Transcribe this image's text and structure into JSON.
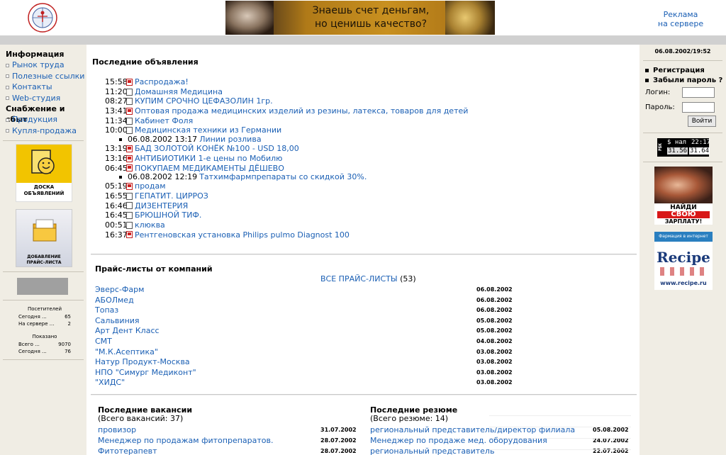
{
  "header": {
    "logo_text": "МЕДИЦИНСКАЯ БИРЖА РОССИИ",
    "banner_line1": "Знаешь счет деньгам,",
    "banner_line2": "но ценишь качество?",
    "ad_link_line1": "Реклама",
    "ad_link_line2": "на сервере"
  },
  "sidebar": {
    "group1": "Информация",
    "items1": [
      "Рынок труда",
      "Полезные ссылки",
      "Контакты",
      "Web-студия"
    ],
    "group2": "Снабжение и сбыт",
    "items2": [
      "Продукция",
      "Купля-продажа"
    ],
    "board_label_1": "ДОСКА",
    "board_label_2": "ОБЪЯВЛЕНИЙ",
    "price_label_1": "ДОБАВЛЕНИЕ",
    "price_label_2": "ПРАЙС-ЛИСТА",
    "visitors_title": "Посетителей",
    "visitors": [
      {
        "label": "Сегодня ...",
        "value": "65"
      },
      {
        "label": "На сервере ...",
        "value": "2"
      }
    ],
    "shown_title": "Показано",
    "shown": [
      {
        "label": "Всего ...",
        "value": "9070"
      },
      {
        "label": "Сегодня ...",
        "value": "76"
      }
    ]
  },
  "right": {
    "datetime": "06.08.2002/19:52",
    "register": "Регистрация",
    "forgot": "Забыли пароль ?",
    "login_label": "Логин:",
    "password_label": "Пароль:",
    "login_button": "Войти",
    "rbk_logo": "РБК",
    "rbk_currency": "$ нал",
    "rbk_time": "22:17",
    "rbk_buy": "31.56",
    "rbk_sell": "31.64",
    "salary_line1": "НАЙДИ",
    "salary_line2": "СВОЮ",
    "salary_line3": "ЗАРПЛАТУ!",
    "recipe_header": "Фармация в интернет",
    "recipe_big": "Recipe",
    "recipe_url": "www.recipe.ru"
  },
  "ads": {
    "title": "Последние объявления",
    "items": [
      {
        "time": "15:58",
        "icon": "home",
        "text": "Распродажа!"
      },
      {
        "time": "11:20",
        "icon": "doc",
        "text": "Домашняя Медицина"
      },
      {
        "time": "08:27",
        "icon": "doc",
        "text": "КУПИМ СРОЧНО ЦЕФАЗОЛИН 1гр."
      },
      {
        "time": "13:41",
        "icon": "home",
        "text": "Оптовая продажа медицинских изделий из резины, латекса, товаров для детей"
      },
      {
        "time": "11:34",
        "icon": "doc",
        "text": "Кабинет Фоля"
      },
      {
        "time": "10:00",
        "icon": "doc",
        "text": "Медицинская техники из Германии"
      },
      {
        "sub": true,
        "date": "06.08.2002 13:17",
        "text": "Линии розлива"
      },
      {
        "time": "13:19",
        "icon": "home",
        "text": "БАД ЗОЛОТОЙ КОНЁК №100 - USD 18,00"
      },
      {
        "time": "13:16",
        "icon": "home",
        "text": "АНТИБИОТИКИ 1-е цены по Мобилю"
      },
      {
        "time": "06:45",
        "icon": "home",
        "text": "ПОКУПАЕМ МЕДИКАМЕНТЫ ДЁШЕВО"
      },
      {
        "sub": true,
        "date": "06.08.2002 12:19",
        "text": "Татхимфармпрепараты со скидкой 30%."
      },
      {
        "time": "05:19",
        "icon": "home",
        "text": "продам"
      },
      {
        "time": "16:55",
        "icon": "doc",
        "text": "ГЕПАТИТ. ЦИРРОЗ"
      },
      {
        "time": "16:46",
        "icon": "doc",
        "text": "ДИЗЕНТЕРИЯ"
      },
      {
        "time": "16:45",
        "icon": "doc",
        "text": "БРЮШНОЙ ТИФ."
      },
      {
        "time": "00:51",
        "icon": "doc",
        "text": "клюква"
      },
      {
        "time": "16:37",
        "icon": "home",
        "text": "Рентгеновская установка Philips pulmo Diagnost 100"
      }
    ]
  },
  "prices": {
    "title": "Прайс-листы от компаний",
    "all_link": "ВСЕ ПРАЙС-ЛИСТЫ",
    "all_count": "(53)",
    "items": [
      {
        "name": "Эверс-Фарм",
        "date": "06.08.2002"
      },
      {
        "name": "АБОЛмед",
        "date": "06.08.2002"
      },
      {
        "name": "Топаз",
        "date": "06.08.2002"
      },
      {
        "name": "Сальвиния",
        "date": "05.08.2002"
      },
      {
        "name": "Арт Дент Класс",
        "date": "05.08.2002"
      },
      {
        "name": "СМТ",
        "date": "04.08.2002"
      },
      {
        "name": "\"М.К.Асептика\"",
        "date": "03.08.2002"
      },
      {
        "name": "Натур Продукт-Москва",
        "date": "03.08.2002"
      },
      {
        "name": "НПО \"Симург Медиконт\"",
        "date": "03.08.2002"
      },
      {
        "name": "\"ХИДС\"",
        "date": "03.08.2002"
      }
    ]
  },
  "vacancies": {
    "title": "Последние вакансии",
    "subtitle": "(Всего вакансий: 37)",
    "items": [
      {
        "name": "провизор",
        "date": "31.07.2002"
      },
      {
        "name": "Менеджер по продажам фитопрепаратов.",
        "date": "28.07.2002"
      },
      {
        "name": "Фитотерапевт",
        "date": "28.07.2002"
      }
    ]
  },
  "resumes": {
    "title": "Последние резюме",
    "subtitle": "(Всего резюме: 14)",
    "items": [
      {
        "name": "региональный представитель/директор филиала",
        "date": "05.08.2002"
      },
      {
        "name": "Менеджер по продаже мед. оборудования",
        "date": "24.07.2002"
      },
      {
        "name": "региональный представитель",
        "date": "22.07.2002"
      }
    ]
  }
}
